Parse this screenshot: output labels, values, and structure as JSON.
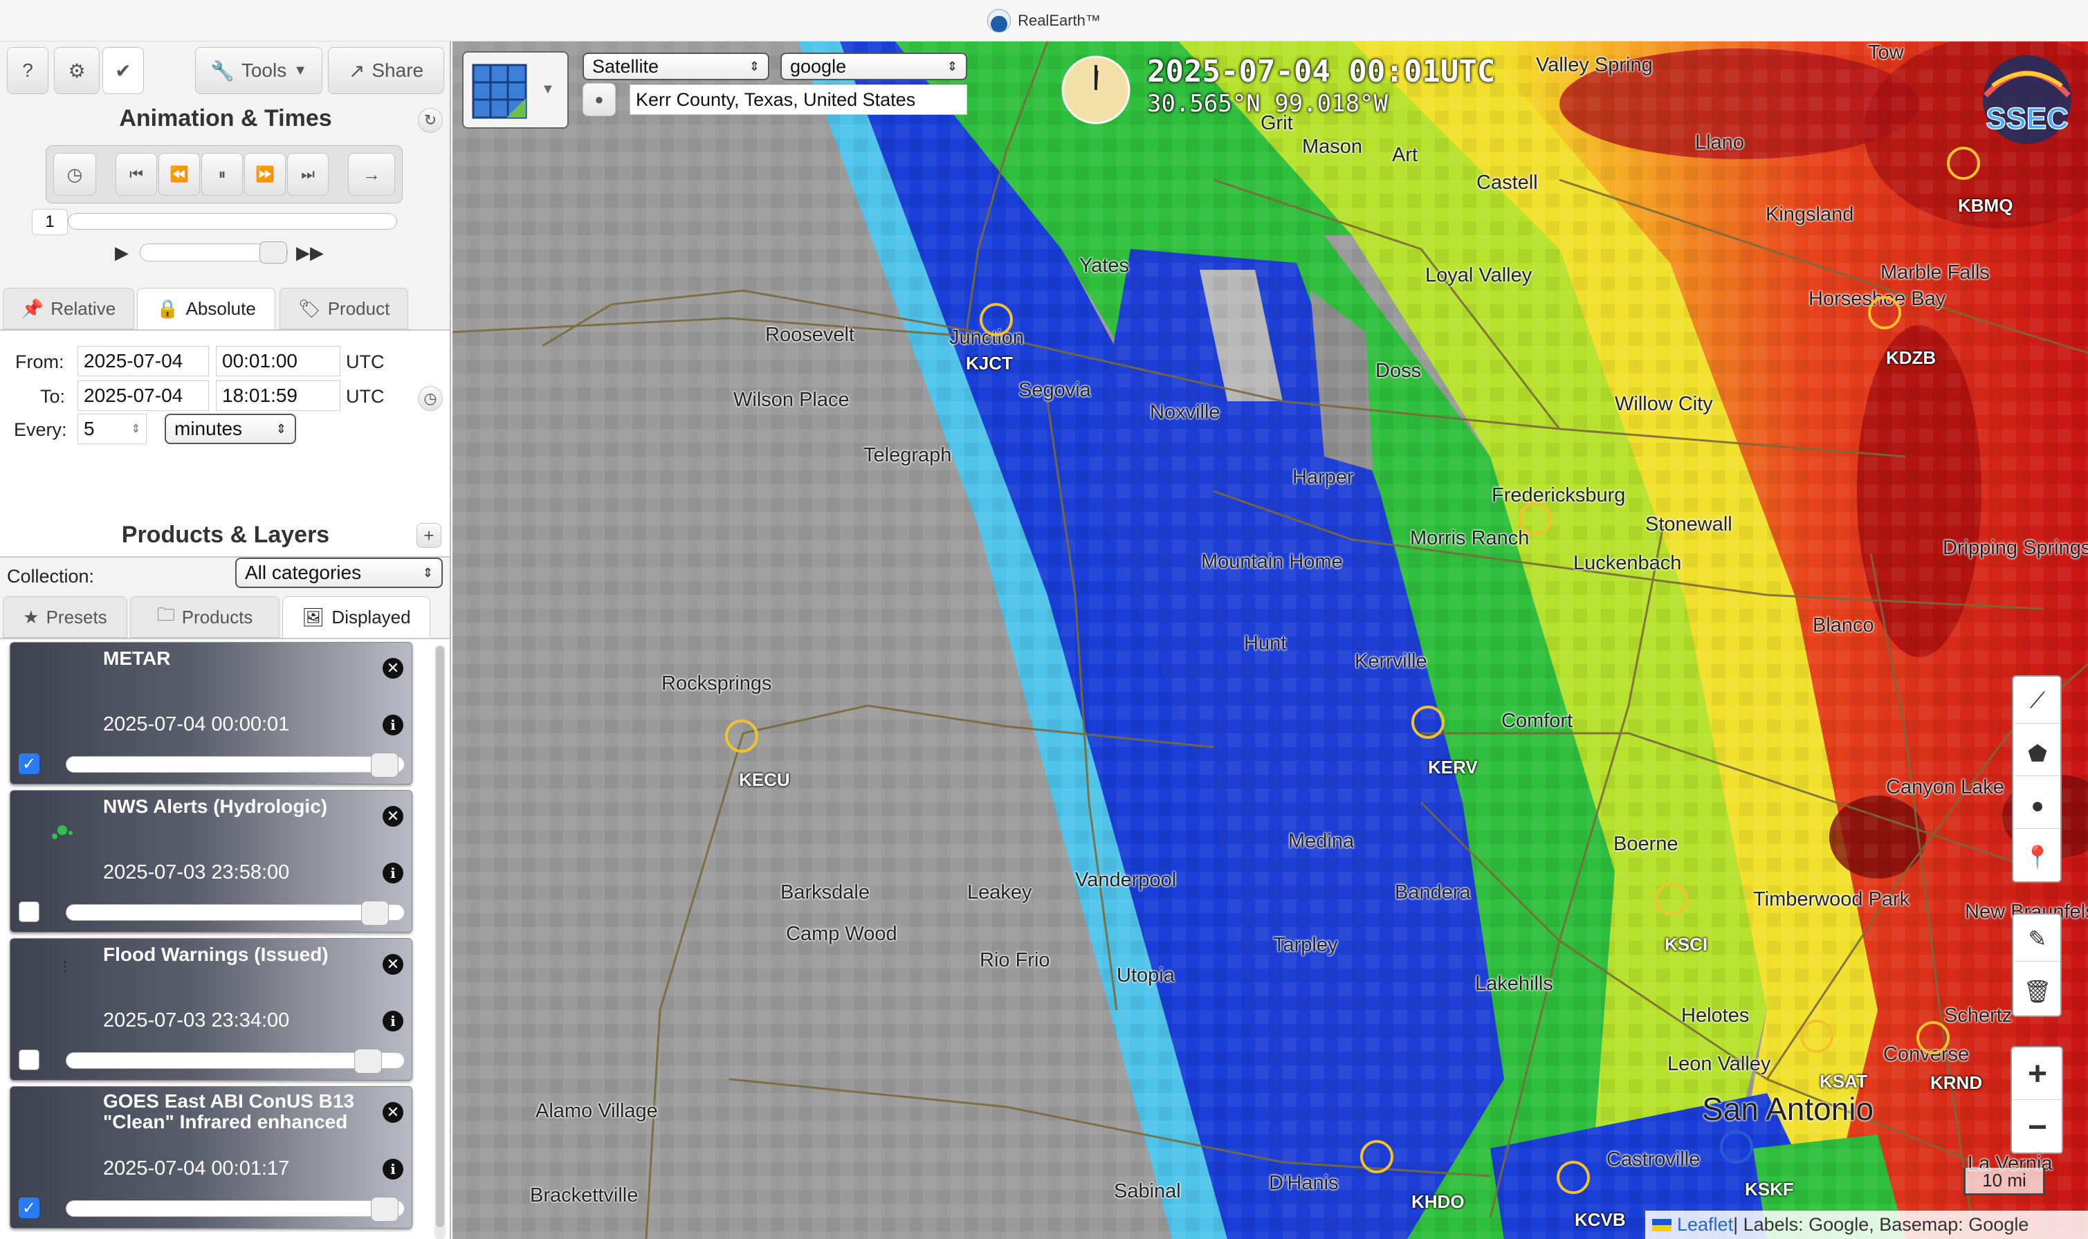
{
  "window": {
    "title": "RealEarth™"
  },
  "toolbar": {
    "help_label": "?",
    "settings_label": "⚙",
    "check_label": "✔",
    "tools_label": "Tools",
    "share_label": "Share"
  },
  "animation": {
    "title": "Animation & Times",
    "frame_number": "1",
    "tabs": [
      {
        "label": "Relative"
      },
      {
        "label": "Absolute"
      },
      {
        "label": "Product"
      }
    ],
    "from_label": "From:",
    "to_label": "To:",
    "every_label": "Every:",
    "from_date": "2025-07-04",
    "from_time": "00:01:00",
    "to_date": "2025-07-04",
    "to_time": "18:01:59",
    "tz_from": "UTC",
    "tz_to": "UTC",
    "every_value": "5",
    "every_unit": "minutes"
  },
  "products": {
    "title": "Products & Layers",
    "collection_label": "Collection:",
    "collection_value": "All categories",
    "tabs": [
      {
        "label": "Presets"
      },
      {
        "label": "Products"
      },
      {
        "label": "Displayed"
      }
    ],
    "layers": [
      {
        "name": "METAR",
        "time": "2025-07-04 00:00:01",
        "checked": true
      },
      {
        "name": "NWS Alerts (Hydrologic)",
        "time": "2025-07-03 23:58:00",
        "checked": false
      },
      {
        "name": "Flood Warnings (Issued)",
        "time": "2025-07-03 23:34:00",
        "checked": false
      },
      {
        "name": "GOES East ABI ConUS B13 \"Clean\" Infrared enhanced",
        "time": "2025-07-04 00:01:17",
        "checked": true
      }
    ]
  },
  "map": {
    "basemap_select": "Satellite",
    "labels_select": "google",
    "location_search": "Kerr County, Texas, United States",
    "datetime": "2025-07-04  00:01UTC",
    "coords": "30.565°N 99.018°W",
    "scale": "10 mi",
    "attribution_leaflet": "Leaflet",
    "attribution_rest": " | Labels: Google, Basemap: Google",
    "towns": [
      "Junction",
      "Roosevelt",
      "Wilson Place",
      "Telegraph",
      "Segovia",
      "Noxville",
      "Yates",
      "Loyal Valley",
      "Doss",
      "Harper",
      "Mountain Home",
      "Hunt",
      "Kerrville",
      "Comfort",
      "Fredericksburg",
      "Morris Ranch",
      "Luckenbach",
      "Stonewall",
      "Willow City",
      "Castell",
      "Llano",
      "Kingsland",
      "Marble Falls",
      "Horseshoe Bay",
      "Mason",
      "Art",
      "Valley Spring",
      "Rocksprings",
      "Barksdale",
      "Camp Wood",
      "Leakey",
      "Rio Frio",
      "Vanderpool",
      "Utopia",
      "Medina",
      "Bandera",
      "Tarpley",
      "Lakehills",
      "Helotes",
      "Leon Valley",
      "Boerne",
      "Timberwood Park",
      "Blanco",
      "Canyon Lake",
      "New Braunfels",
      "Schertz",
      "Converse",
      "Castroville",
      "D'Hanis",
      "Sabinal",
      "Brackettville",
      "Alamo Village",
      "San Antonio",
      "La Vernia",
      "Grit",
      "Tow",
      "Dripping Springs"
    ],
    "stations": [
      "KJCT",
      "KECU",
      "KERV",
      "KSKF",
      "KSAT",
      "KHDO",
      "KCVB",
      "KSCI",
      "KBMQ",
      "KDZB",
      "KRND"
    ],
    "tools": [
      "line-draw",
      "polygon-draw",
      "circle-draw",
      "marker-draw",
      "edit",
      "delete"
    ],
    "zoom_in": "+",
    "zoom_out": "−"
  }
}
